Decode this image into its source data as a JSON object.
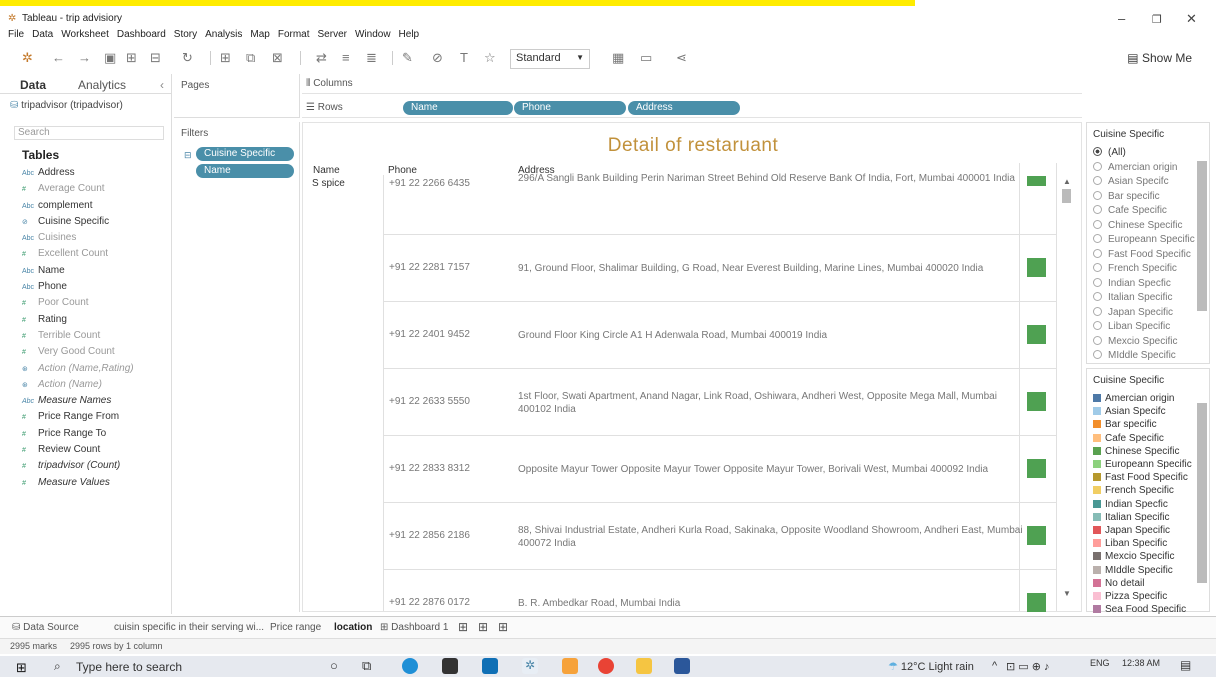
{
  "window": {
    "title": "Tableau - trip advisiory"
  },
  "menu": [
    "File",
    "Data",
    "Worksheet",
    "Dashboard",
    "Story",
    "Analysis",
    "Map",
    "Format",
    "Server",
    "Window",
    "Help"
  ],
  "toolbar": {
    "view_mode": "Standard",
    "show_me": "Show Me"
  },
  "data_pane": {
    "tabs": [
      "Data",
      "Analytics"
    ],
    "datasource": "tripadvisor (tripadvisor)",
    "search_placeholder": "Search",
    "tables_heading": "Tables",
    "fields": [
      {
        "icon": "Abc",
        "name": "Address",
        "kind": "dim"
      },
      {
        "icon": "#",
        "name": "Average Count",
        "kind": "meas",
        "muted": true
      },
      {
        "icon": "Abc",
        "name": "complement",
        "kind": "dim"
      },
      {
        "icon": "⊘",
        "name": "Cuisine Specific",
        "kind": "dim"
      },
      {
        "icon": "Abc",
        "name": "Cuisines",
        "kind": "dim",
        "muted": true
      },
      {
        "icon": "#",
        "name": "Excellent Count",
        "kind": "meas",
        "muted": true
      },
      {
        "icon": "Abc",
        "name": "Name",
        "kind": "dim"
      },
      {
        "icon": "Abc",
        "name": "Phone",
        "kind": "dim"
      },
      {
        "icon": "#",
        "name": "Poor Count",
        "kind": "meas",
        "muted": true
      },
      {
        "icon": "#",
        "name": "Rating",
        "kind": "meas"
      },
      {
        "icon": "#",
        "name": "Terrible Count",
        "kind": "meas",
        "muted": true
      },
      {
        "icon": "#",
        "name": "Very Good Count",
        "kind": "meas",
        "muted": true
      },
      {
        "icon": "⊛",
        "name": "Action (Name,Rating)",
        "kind": "dim",
        "italic": true,
        "muted": true
      },
      {
        "icon": "⊛",
        "name": "Action (Name)",
        "kind": "dim",
        "italic": true,
        "muted": true
      },
      {
        "icon": "Abc",
        "name": "Measure Names",
        "kind": "dim",
        "italic": true
      },
      {
        "icon": "#",
        "name": "Price Range From",
        "kind": "meas"
      },
      {
        "icon": "#",
        "name": "Price Range To",
        "kind": "meas"
      },
      {
        "icon": "#",
        "name": "Review Count",
        "kind": "meas"
      },
      {
        "icon": "#",
        "name": "tripadvisor (Count)",
        "kind": "meas",
        "italic": true
      },
      {
        "icon": "#",
        "name": "Measure Values",
        "kind": "meas",
        "italic": true
      }
    ]
  },
  "pages": {
    "label": "Pages"
  },
  "filters": {
    "label": "Filters",
    "pills": [
      "Cuisine Specific",
      "Name"
    ]
  },
  "shelves": {
    "columns_label": "Columns",
    "rows_label": "Rows",
    "rows_pills": [
      "Name",
      "Phone",
      "Address"
    ]
  },
  "viz": {
    "title": "Detail of restaruant",
    "col_headers": [
      "Name",
      "Phone",
      "Address"
    ],
    "rows": [
      {
        "name": "S spice",
        "phone": "+91 22 2266 6435",
        "address": "296/A Sangli Bank Building Perin Nariman Street Behind Old Reserve Bank Of India, Fort, Mumbai 400001 India"
      },
      {
        "name": "",
        "phone": "+91 22 2281 7157",
        "address": "91, Ground Floor, Shalimar Building, G Road, Near Everest Building, Marine Lines, Mumbai 400020 India"
      },
      {
        "name": "",
        "phone": "+91 22 2401 9452",
        "address": "Ground Floor King Circle A1 H Adenwala Road, Mumbai 400019 India"
      },
      {
        "name": "",
        "phone": "+91 22 2633 5550",
        "address": "1st Floor, Swati Apartment, Anand Nagar, Link Road, Oshiwara, Andheri West, Opposite Mega Mall, Mumbai 400102 India"
      },
      {
        "name": "",
        "phone": "+91 22 2833 8312",
        "address": "Opposite Mayur Tower Opposite Mayur Tower Opposite Mayur Tower, Borivali West, Mumbai 400092 India"
      },
      {
        "name": "",
        "phone": "+91 22 2856 2186",
        "address": "88, Shivai Industrial Estate, Andheri Kurla Road, Sakinaka, Opposite Woodland Showroom, Andheri East, Mumbai 400072 India"
      },
      {
        "name": "",
        "phone": "+91 22 2876 0172",
        "address": "B. R. Ambedkar Road, Mumbai India"
      }
    ],
    "mark_color": "#4fa152"
  },
  "filter_card": {
    "title": "Cuisine Specific",
    "options": [
      "(All)",
      "Amercian origin",
      "Asian Specifc",
      "Bar specific",
      "Cafe Specific",
      "Chinese Specific",
      "Europeann Specific",
      "Fast Food Specific",
      "French Specific",
      "Indian Specfic",
      "Italian Specific",
      "Japan Specific",
      "Liban Specific",
      "Mexcio Specific",
      "MIddle Specific"
    ],
    "selected": "(All)"
  },
  "color_legend": {
    "title": "Cuisine Specific",
    "items": [
      {
        "label": "Amercian origin",
        "color": "#4e79a7"
      },
      {
        "label": "Asian Specifc",
        "color": "#a0cbe8"
      },
      {
        "label": "Bar specific",
        "color": "#f28e2b"
      },
      {
        "label": "Cafe Specific",
        "color": "#ffbe7d"
      },
      {
        "label": "Chinese Specific",
        "color": "#59a14f"
      },
      {
        "label": "Europeann Specific",
        "color": "#8cd17d"
      },
      {
        "label": "Fast Food Specific",
        "color": "#b6992d"
      },
      {
        "label": "French Specific",
        "color": "#f1ce63"
      },
      {
        "label": "Indian Specfic",
        "color": "#499894"
      },
      {
        "label": "Italian Specific",
        "color": "#86bcb6"
      },
      {
        "label": "Japan Specific",
        "color": "#e15759"
      },
      {
        "label": "Liban Specific",
        "color": "#ff9d9a"
      },
      {
        "label": "Mexcio Specific",
        "color": "#79706e"
      },
      {
        "label": "MIddle Specific",
        "color": "#bab0ac"
      },
      {
        "label": "No detail",
        "color": "#d37295"
      },
      {
        "label": "Pizza Specific",
        "color": "#fabfd2"
      },
      {
        "label": "Sea Food Specific",
        "color": "#b07aa1"
      }
    ]
  },
  "sheet_tabs": [
    "Data Source",
    "cuisin specific in their serving wi...",
    "Price range",
    "location",
    "Dashboard 1"
  ],
  "active_tab": "location",
  "status": {
    "marks": "2995 marks",
    "rows": "2995 rows by 1 column"
  },
  "taskbar": {
    "search_placeholder": "Type here to search",
    "weather": "12°C  Light rain",
    "lang": "ENG",
    "time": "12:38 AM"
  }
}
